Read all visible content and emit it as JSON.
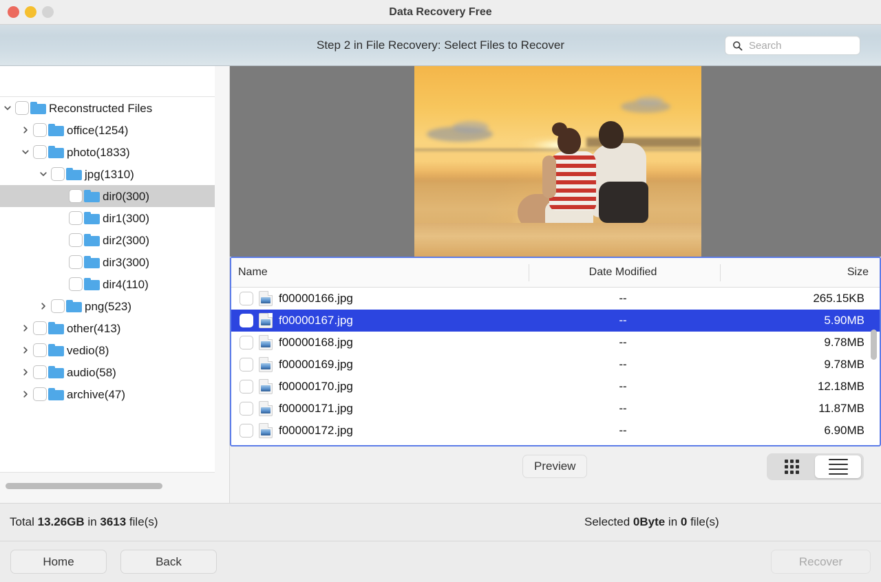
{
  "window": {
    "title": "Data Recovery Free",
    "controls": {
      "close": "close-button",
      "minimize": "minimize-button",
      "zoom": "zoom-button"
    }
  },
  "toolbar": {
    "step_title": "Step 2 in File Recovery: Select Files to Recover",
    "search": {
      "placeholder": "Search",
      "value": "",
      "icon": "search-icon"
    }
  },
  "sidebar": {
    "tree": [
      {
        "label": "Reconstructed Files",
        "depth": 0,
        "expander": "expanded",
        "checked": false,
        "selected": false
      },
      {
        "label": "office(1254)",
        "depth": 1,
        "expander": "collapsed",
        "checked": false,
        "selected": false
      },
      {
        "label": "photo(1833)",
        "depth": 1,
        "expander": "expanded",
        "checked": false,
        "selected": false
      },
      {
        "label": "jpg(1310)",
        "depth": 2,
        "expander": "expanded",
        "checked": false,
        "selected": false
      },
      {
        "label": "dir0(300)",
        "depth": 3,
        "expander": "none",
        "checked": false,
        "selected": true
      },
      {
        "label": "dir1(300)",
        "depth": 3,
        "expander": "none",
        "checked": false,
        "selected": false
      },
      {
        "label": "dir2(300)",
        "depth": 3,
        "expander": "none",
        "checked": false,
        "selected": false
      },
      {
        "label": "dir3(300)",
        "depth": 3,
        "expander": "none",
        "checked": false,
        "selected": false
      },
      {
        "label": "dir4(110)",
        "depth": 3,
        "expander": "none",
        "checked": false,
        "selected": false
      },
      {
        "label": "png(523)",
        "depth": 2,
        "expander": "collapsed",
        "checked": false,
        "selected": false
      },
      {
        "label": "other(413)",
        "depth": 1,
        "expander": "collapsed",
        "checked": false,
        "selected": false
      },
      {
        "label": "vedio(8)",
        "depth": 1,
        "expander": "collapsed",
        "checked": false,
        "selected": false
      },
      {
        "label": "audio(58)",
        "depth": 1,
        "expander": "collapsed",
        "checked": false,
        "selected": false
      },
      {
        "label": "archive(47)",
        "depth": 1,
        "expander": "collapsed",
        "checked": false,
        "selected": false
      }
    ]
  },
  "preview": {
    "image_alt": "sunset-photo-couple-on-beach",
    "background_color": "#7b7b7b"
  },
  "filelist": {
    "columns": {
      "name": "Name",
      "date_modified": "Date Modified",
      "size": "Size"
    },
    "rows": [
      {
        "name": "f00000166.jpg",
        "date": "--",
        "size": "265.15KB",
        "checked": false,
        "selected": false
      },
      {
        "name": "f00000167.jpg",
        "date": "--",
        "size": "5.90MB",
        "checked": false,
        "selected": true
      },
      {
        "name": "f00000168.jpg",
        "date": "--",
        "size": "9.78MB",
        "checked": false,
        "selected": false
      },
      {
        "name": "f00000169.jpg",
        "date": "--",
        "size": "9.78MB",
        "checked": false,
        "selected": false
      },
      {
        "name": "f00000170.jpg",
        "date": "--",
        "size": "12.18MB",
        "checked": false,
        "selected": false
      },
      {
        "name": "f00000171.jpg",
        "date": "--",
        "size": "11.87MB",
        "checked": false,
        "selected": false
      },
      {
        "name": "f00000172.jpg",
        "date": "--",
        "size": "6.90MB",
        "checked": false,
        "selected": false
      }
    ],
    "selection_color": "#2c45e0",
    "focus_border_color": "#5b7be8"
  },
  "controls": {
    "preview_label": "Preview",
    "view_modes": [
      {
        "name": "grid-view",
        "icon": "grid-icon",
        "active": false
      },
      {
        "name": "list-view",
        "icon": "list-icon",
        "active": true
      }
    ]
  },
  "status": {
    "total_prefix": "Total ",
    "total_size": "13.26GB",
    "total_mid": " in ",
    "total_count": "3613",
    "total_suffix": " file(s)",
    "selected_prefix": "Selected ",
    "selected_size": "0Byte",
    "selected_mid": " in ",
    "selected_count": "0",
    "selected_suffix": " file(s)"
  },
  "footer": {
    "home_label": "Home",
    "back_label": "Back",
    "recover_label": "Recover",
    "recover_disabled": true
  }
}
